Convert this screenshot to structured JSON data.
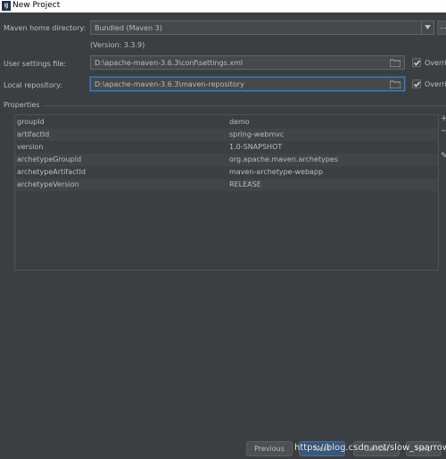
{
  "window": {
    "title": "New Project",
    "logo_text": "IJ"
  },
  "maven_home": {
    "label": "Maven home directory:",
    "value": "Bundled (Maven 3)",
    "browse_label": "...",
    "version_note": "(Version: 3.3.9)"
  },
  "user_settings": {
    "label": "User settings file:",
    "value": "D:\\apache-maven-3.6.3\\conf\\settings.xml",
    "override_label": "Override",
    "override_checked": true
  },
  "local_repo": {
    "label": "Local repository:",
    "value": "D:\\apache-maven-3.6.3\\maven-repository",
    "override_label": "Override",
    "override_checked": true
  },
  "properties": {
    "section_label": "Properties",
    "rows": [
      {
        "key": "groupId",
        "value": "demo"
      },
      {
        "key": "artifactId",
        "value": "spring-webmvc"
      },
      {
        "key": "version",
        "value": "1.0-SNAPSHOT"
      },
      {
        "key": "archetypeGroupId",
        "value": "org.apache.maven.archetypes"
      },
      {
        "key": "archetypeArtifactId",
        "value": "maven-archetype-webapp"
      },
      {
        "key": "archetypeVersion",
        "value": "RELEASE"
      }
    ],
    "side_buttons": [
      "+",
      "−",
      "✎"
    ]
  },
  "buttons": {
    "previous": "Previous",
    "next": "Next",
    "cancel": "Cancel",
    "help": "Help"
  },
  "watermark": "https://blog.csdn.net/slow_sparrow",
  "colors": {
    "background": "#3c3f41",
    "accent": "#3d7cc1",
    "primary_button": "#365880"
  }
}
